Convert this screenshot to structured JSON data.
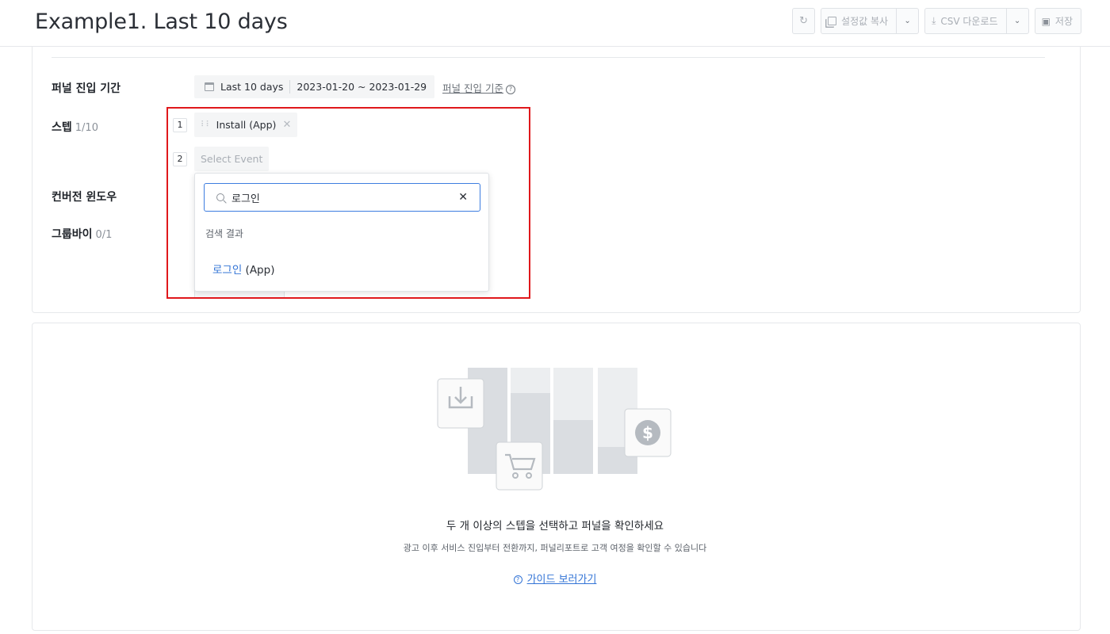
{
  "header": {
    "title": "Example1. Last 10 days",
    "refresh_icon": "refresh-icon",
    "copy_settings_label": "설정값 복사",
    "csv_download_label": "CSV 다운로드",
    "save_label": "저장"
  },
  "settings": {
    "period_label": "퍼널 진입 기간",
    "period_preset": "Last 10 days",
    "period_range": "2023-01-20 ~ 2023-01-29",
    "criteria_link": "퍼널 진입 기준",
    "steps_label": "스텝",
    "steps_count": "1/10",
    "steps": [
      {
        "num": "1",
        "label": "Install (App)"
      },
      {
        "num": "2",
        "label": "Select Event"
      }
    ],
    "conversion_window_label": "컨버전 윈도우",
    "group_by_label": "그룹바이",
    "group_by_count": "0/1"
  },
  "dropdown": {
    "search_value": "로그인",
    "results_heading": "검색 결과",
    "result_highlight": "로그인",
    "result_rest": " (App)"
  },
  "empty_state": {
    "title": "두 개 이상의 스텝을 선택하고 퍼널을 확인하세요",
    "subtitle": "광고 이후 서비스 진입부터 전환까지, 퍼널리포트로 고객 여정을 확인할 수 있습니다",
    "guide_link": "가이드 보러가기"
  },
  "colors": {
    "accent": "#3374d6",
    "highlight_border": "#e0181c"
  }
}
